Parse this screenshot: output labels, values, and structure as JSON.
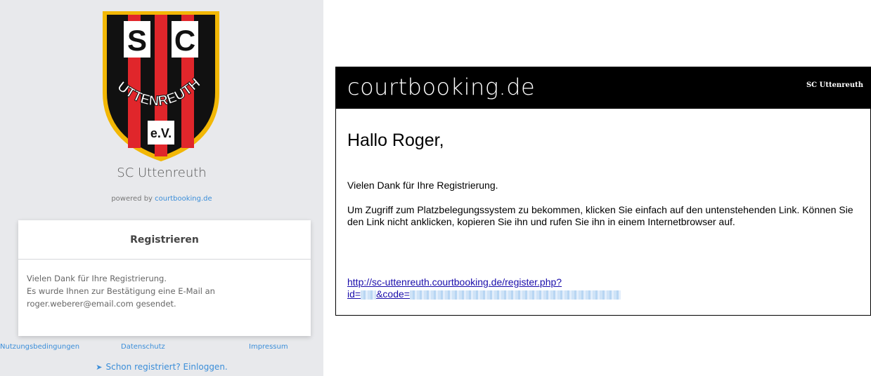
{
  "left": {
    "club_name": "SC Uttenreuth",
    "powered_by": "powered by",
    "powered_by_link": "courtbooking.de",
    "crest": {
      "letters_top": "S C",
      "letters_arc": "UTTENREUTH",
      "letters_bottom": "e.V.",
      "colors": {
        "black": "#111111",
        "red": "#e0262b",
        "gold": "#f2b705",
        "white": "#ffffff"
      }
    },
    "card": {
      "title": "Registrieren",
      "body_line1": "Vielen Dank für Ihre Registrierung.",
      "body_line2": "Es wurde Ihnen zur Bestätigung eine E-Mail an",
      "body_line3": "roger.weberer@email.com gesendet."
    },
    "footer": {
      "terms": "Nutzungsbedingungen",
      "privacy": "Datenschutz",
      "imprint": "Impressum"
    },
    "login_link": "Schon registriert? Einloggen.",
    "accent_color": "#3b8ed9"
  },
  "email": {
    "brand": "courtbooking.de",
    "header_club": "SC Uttenreuth",
    "greeting": "Hallo Roger,",
    "para_thanks": "Vielen Dank für Ihre Registrierung.",
    "para_instructions": "Um Zugriff zum Platzbelegungssystem zu bekommen, klicken Sie einfach auf den untenstehenden Link. Können Sie den Link nicht anklicken, kopieren Sie ihn und rufen Sie ihn in einem Internetbrowser auf.",
    "link_line1": "http://sc-uttenreuth.courtbooking.de/register.php?",
    "link_id_prefix": "id=",
    "link_code_prefix": "&code="
  }
}
